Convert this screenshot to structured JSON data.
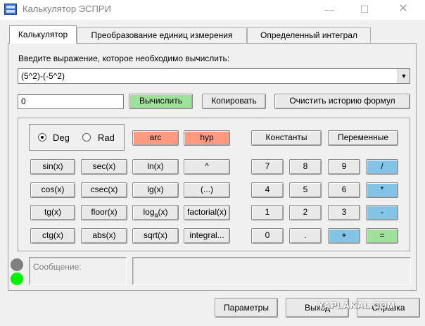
{
  "window": {
    "title": "Калькулятор ЭСПРИ",
    "minimize": "—",
    "maximize": "☐",
    "close": "✕"
  },
  "tabs": [
    {
      "label": "Калькулятор",
      "active": true
    },
    {
      "label": "Преобразование единиц измерения",
      "active": false
    },
    {
      "label": "Определенный интеграл",
      "active": false
    }
  ],
  "expression": {
    "label": "Введите выражение, которое необходимо вычислить:",
    "value": "(5^2)-(-5^2)"
  },
  "result": {
    "value": "0"
  },
  "actions": {
    "compute": "Вычислить",
    "copy": "Копировать",
    "clear_history": "Очистить историю формул"
  },
  "angle_mode": {
    "deg": "Deg",
    "rad": "Rad",
    "selected": "Deg"
  },
  "func_buttons": {
    "arc": "arc",
    "hyp": "hyp",
    "sin": "sin(x)",
    "cos": "cos(x)",
    "tg": "tg(x)",
    "ctg": "ctg(x)",
    "sec": "sec(x)",
    "csec": "csec(x)",
    "floor": "floor(x)",
    "abs": "abs(x)",
    "ln": "ln(x)",
    "lg": "lg(x)",
    "log_a_prefix": "log",
    "log_a_sub": "a",
    "log_a_suffix": "(x)",
    "sqrt": "sqrt(x)",
    "pow": "^",
    "parens": "(...)",
    "factorial": "factorial(x)",
    "integral": "integral..."
  },
  "top_buttons": {
    "constants": "Константы",
    "variables": "Переменные"
  },
  "keypad": {
    "k7": "7",
    "k8": "8",
    "k9": "9",
    "div": "/",
    "k4": "4",
    "k5": "5",
    "k6": "6",
    "mul": "*",
    "k1": "1",
    "k2": "2",
    "k3": "3",
    "sub": "-",
    "k0": "0",
    "dot": ".",
    "add": "+",
    "eq": "="
  },
  "message": {
    "label": "Сообщение:",
    "text": ""
  },
  "bottom_buttons": {
    "params": "Параметры",
    "exit": "Выход",
    "help": "Справка"
  },
  "watermark": "YAPLAKAL.COM",
  "colors": {
    "compute_button": "#9fe09b",
    "arc_hyp_buttons": "#ff9a80",
    "operator_buttons": "#82c3e6",
    "status_green": "#00f000",
    "status_gray": "#7f7f7f"
  }
}
